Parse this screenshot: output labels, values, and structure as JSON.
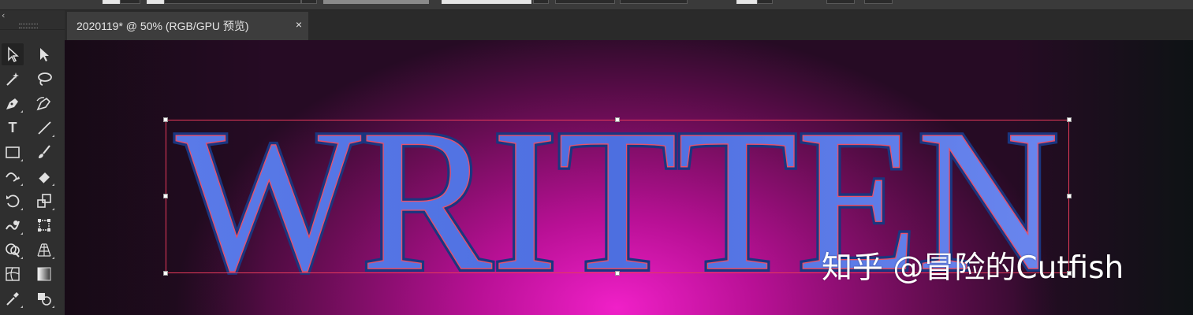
{
  "app": {
    "accent_bg": "#323232",
    "canvas_colors": {
      "center": "#f020c8",
      "mid": "#6a0d55",
      "edge": "#260b24"
    },
    "selection_color": "#e83a5a"
  },
  "toolbox": {
    "collapse_glyph": "‹",
    "tools": [
      {
        "name": "selection-tool",
        "icon": "arrow-outline-icon"
      },
      {
        "name": "direct-selection-tool",
        "icon": "arrow-filled-icon"
      },
      {
        "name": "magic-wand-tool",
        "icon": "magic-wand-icon"
      },
      {
        "name": "lasso-tool",
        "icon": "lasso-icon"
      },
      {
        "name": "pen-tool",
        "icon": "pen-icon"
      },
      {
        "name": "curvature-tool",
        "icon": "curvature-pen-icon"
      },
      {
        "name": "type-tool",
        "icon": "type-icon",
        "glyph": "T"
      },
      {
        "name": "line-tool",
        "icon": "line-segment-icon"
      },
      {
        "name": "rectangle-tool",
        "icon": "rectangle-icon"
      },
      {
        "name": "paintbrush-tool",
        "icon": "paintbrush-icon"
      },
      {
        "name": "shaper-tool",
        "icon": "shaper-icon"
      },
      {
        "name": "eraser-tool",
        "icon": "eraser-icon"
      },
      {
        "name": "rotate-tool",
        "icon": "rotate-icon"
      },
      {
        "name": "scale-tool",
        "icon": "scale-icon"
      },
      {
        "name": "warp-tool",
        "icon": "warp-icon"
      },
      {
        "name": "free-transform-tool",
        "icon": "free-transform-icon"
      },
      {
        "name": "shape-builder-tool",
        "icon": "shape-builder-icon"
      },
      {
        "name": "perspective-grid-tool",
        "icon": "perspective-grid-icon"
      },
      {
        "name": "mesh-tool",
        "icon": "mesh-icon"
      },
      {
        "name": "gradient-tool",
        "icon": "gradient-icon"
      },
      {
        "name": "eyedropper-tool",
        "icon": "eyedropper-icon"
      },
      {
        "name": "blend-tool",
        "icon": "blend-icon"
      }
    ]
  },
  "document_tab": {
    "title": "2020119* @ 50% (RGB/GPU 预览)",
    "close_glyph": "×"
  },
  "artwork": {
    "text": "WRITTEN"
  },
  "watermark": {
    "text": "知乎 @冒险的Cutfish"
  }
}
